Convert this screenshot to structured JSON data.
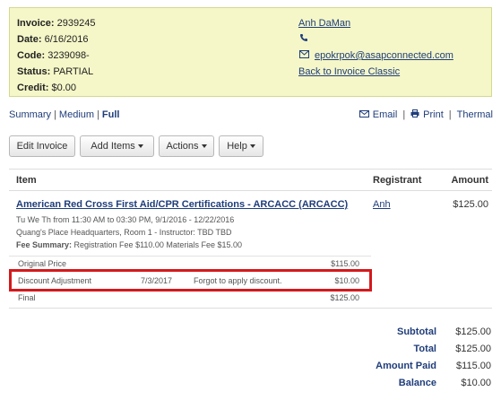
{
  "invoice": {
    "invoice_label": "Invoice:",
    "invoice_value": "2939245",
    "date_label": "Date:",
    "date_value": "6/16/2016",
    "code_label": "Code:",
    "code_value": "3239098-",
    "status_label": "Status:",
    "status_value": "PARTIAL",
    "credit_label": "Credit:",
    "credit_value": "$0.00"
  },
  "contact": {
    "name": "Anh DaMan",
    "phone_icon": "phone-icon",
    "email_icon": "envelope-icon",
    "email": "epokrpok@asapconnected.com",
    "back_link": "Back to Invoice Classic"
  },
  "views": {
    "summary": "Summary",
    "medium": "Medium",
    "full": "Full",
    "sep": "|"
  },
  "actions": {
    "email": "Email",
    "print": "Print",
    "thermal": "Thermal",
    "sep": "|"
  },
  "toolbar": {
    "edit": "Edit Invoice",
    "add_items": "Add Items",
    "actions": "Actions",
    "help": "Help"
  },
  "table": {
    "headers": {
      "item": "Item",
      "registrant": "Registrant",
      "amount": "Amount"
    },
    "course": {
      "title": "American Red Cross First Aid/CPR Certifications - ARCACC   (ARCACC)",
      "schedule": "Tu We Th from 11:30 AM to 03:30 PM, 9/1/2016 - 12/22/2016",
      "location": "Quang's Place Headquarters, Room 1 - Instructor: TBD TBD",
      "fee_label": "Fee Summary:",
      "fee_text": " Registration Fee $110.00 Materials Fee $15.00",
      "registrant": "Anh",
      "amount": "$125.00"
    },
    "price_rows": {
      "original": {
        "label": "Original Price",
        "amount": "$115.00"
      },
      "discount": {
        "label": "Discount Adjustment",
        "date": "7/3/2017",
        "note": "Forgot to apply discount.",
        "amount": "$10.00"
      },
      "final": {
        "label": "Final",
        "amount": "$125.00"
      }
    }
  },
  "totals": {
    "subtotal_label": "Subtotal",
    "subtotal": "$125.00",
    "total_label": "Total",
    "total": "$125.00",
    "paid_label": "Amount Paid",
    "paid": "$115.00",
    "balance_label": "Balance",
    "balance": "$10.00"
  },
  "colors": {
    "info_bg": "#f5f7c8",
    "link": "#1f3d7a",
    "highlight": "#d4191c"
  }
}
